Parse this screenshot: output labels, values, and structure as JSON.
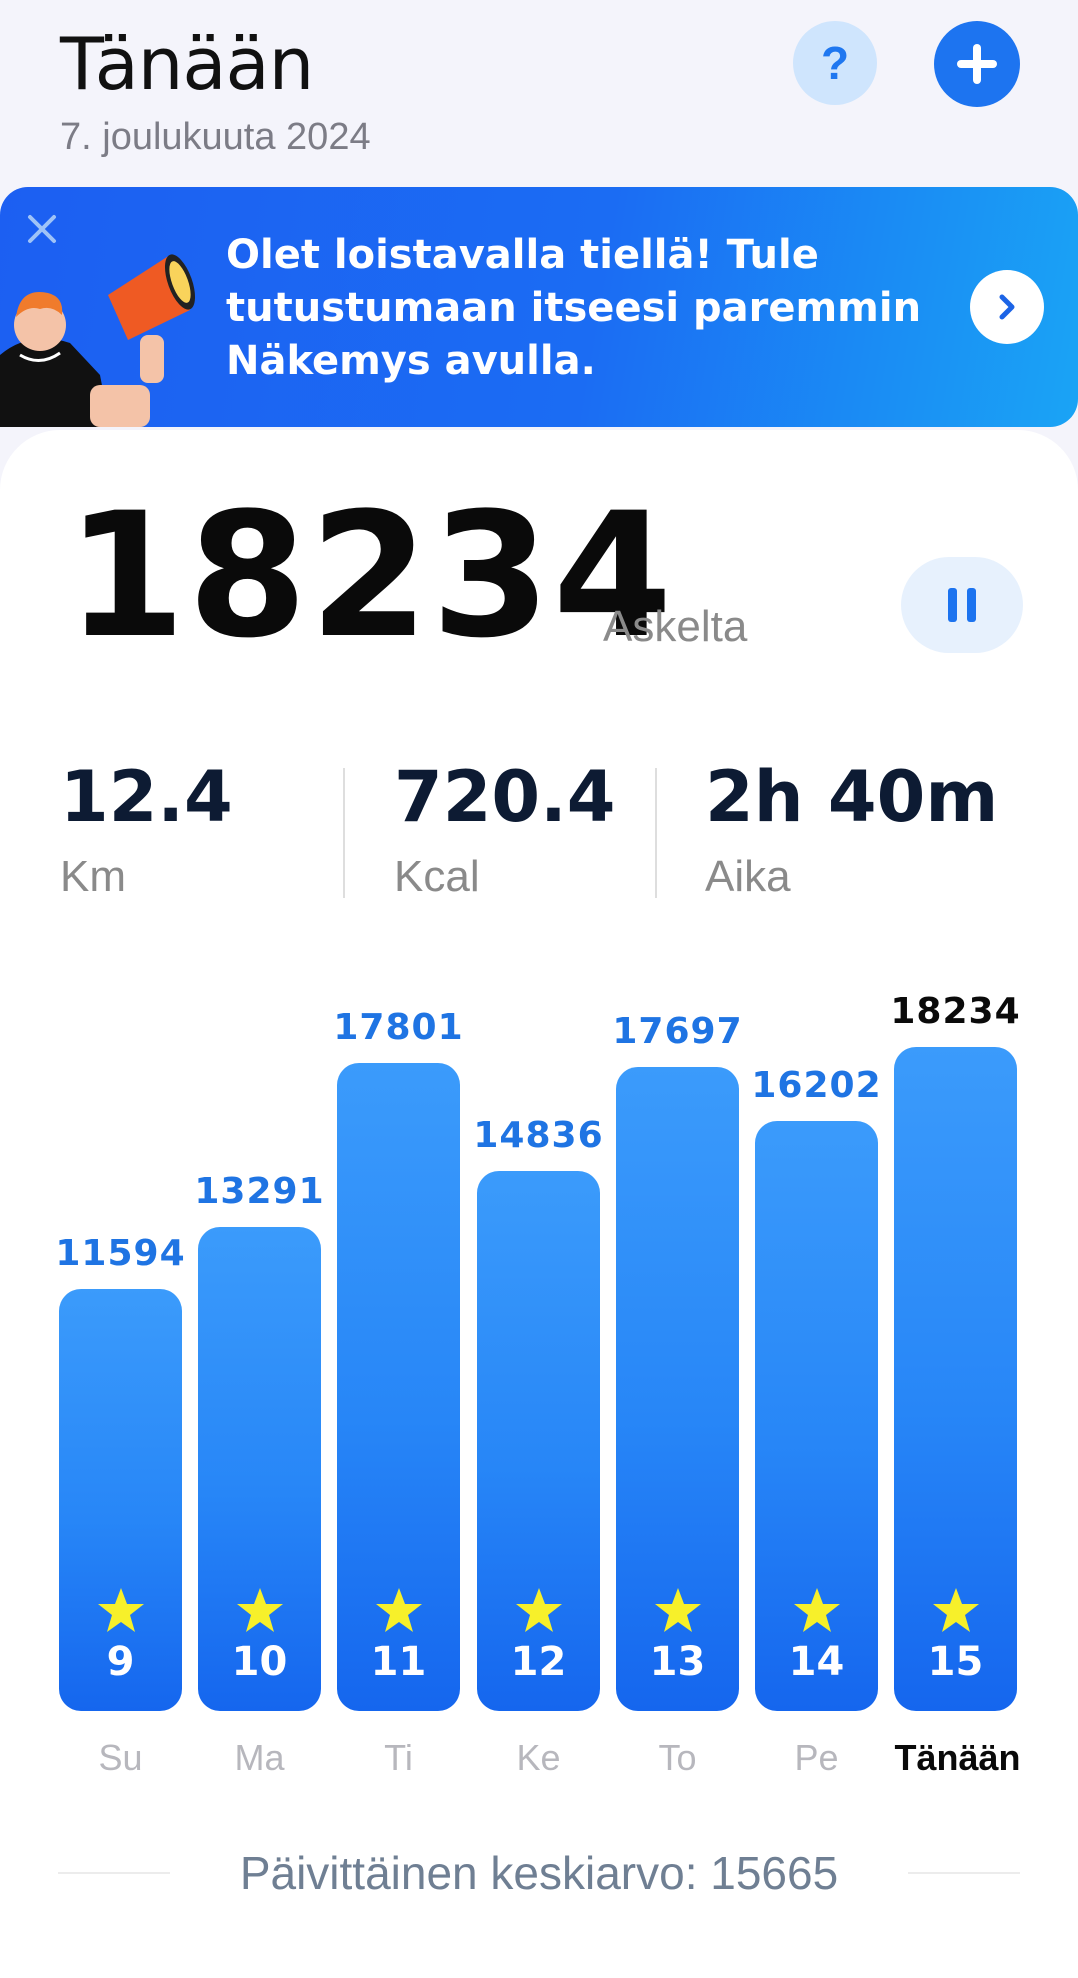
{
  "header": {
    "title": "Tänään",
    "date": "7. joulukuuta 2024",
    "help_label": "?"
  },
  "banner": {
    "text_line1": "Olet loistavalla tiellä! Tule",
    "text_line2": "tutustumaan itseesi paremmin",
    "text_line3": "Näkemys avulla."
  },
  "steps": {
    "count": "18234",
    "unit": "Askelta"
  },
  "stats": [
    {
      "value": "12.4",
      "label": "Km"
    },
    {
      "value": "720.4",
      "label": "Kcal"
    },
    {
      "value": "2h 40m",
      "label": "Aika"
    }
  ],
  "chart_data": {
    "type": "bar",
    "categories": [
      "Su",
      "Ma",
      "Ti",
      "Ke",
      "To",
      "Pe",
      "Tänään"
    ],
    "day_numbers": [
      "9",
      "10",
      "11",
      "12",
      "13",
      "14",
      "15"
    ],
    "values": [
      11594,
      13291,
      17801,
      14836,
      17697,
      16202,
      18234
    ],
    "value_labels": [
      "11594",
      "13291",
      "17801",
      "14836",
      "17697",
      "16202",
      "18234"
    ],
    "highlight_index": 6,
    "goal_reached": [
      true,
      true,
      true,
      true,
      true,
      true,
      true
    ]
  },
  "average": {
    "text": "Päivittäinen keskiarvo: 15665"
  },
  "colors": {
    "accent": "#1d74f0",
    "bar_top": "#3b9bfb",
    "bar_bottom": "#1566ee",
    "star": "#f7f02a",
    "value_label": "#1f74e3"
  }
}
